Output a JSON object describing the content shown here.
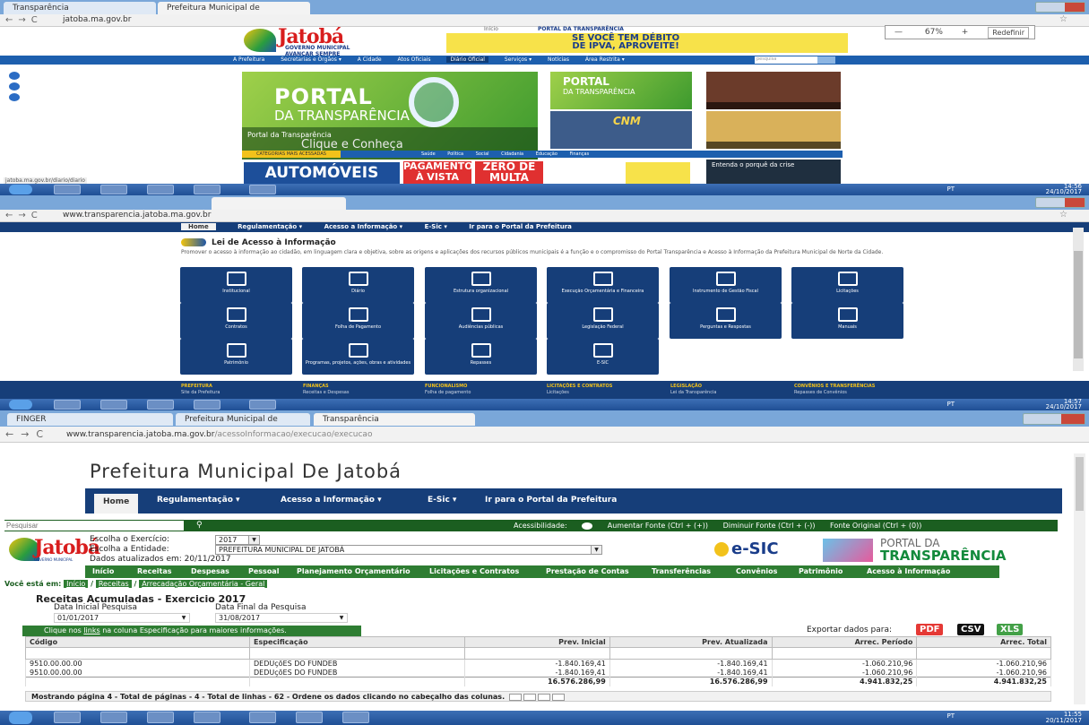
{
  "shot1": {
    "tabs": [
      "Transparência",
      "Prefeitura Municipal de",
      ""
    ],
    "url": "jatoba.ma.gov.br",
    "zoom": {
      "value": "67%",
      "minus": "—",
      "plus": "+",
      "reset": "Redefinir"
    },
    "logo": {
      "name": "Jatobá",
      "subtitle": "GOVERNO MUNICIPAL",
      "slogan": "AVANÇAR SEMPRE"
    },
    "top_links": {
      "home": "Início",
      "portal": "PORTAL DA TRANSPARÊNCIA"
    },
    "ipva_banner": {
      "line1": "SE VOCÊ TEM DÉBITO",
      "line2": "DE IPVA, APROVEITE!"
    },
    "menu": [
      "A Prefeitura",
      "Secretarias e Órgãos ▾",
      "A Cidade",
      "Atos Oficiais",
      "Diário Oficial",
      "Serviços ▾",
      "Notícias",
      "Área Restrita ▾"
    ],
    "search_placeholder": "pesquisa",
    "big_portal": {
      "title": "PORTAL",
      "subtitle": "DA TRANSPARÊNCIA",
      "caption_title": "Portal da Transparência",
      "caption_cta": "Clique e Conheça"
    },
    "small_portal": {
      "title": "PORTAL",
      "subtitle": "DA TRANSPARÊNCIA"
    },
    "cnm_logo": "CNM",
    "categories_label": "CATEGORIAS MAIS ACESSADAS",
    "categories": [
      "Saúde",
      "Política",
      "Social",
      "Cidadania",
      "Educação",
      "Finanças"
    ],
    "autos": "AUTOMÓVEIS",
    "pagamento": {
      "a": "PAGAMENTO À VISTA",
      "b": "ZERO DE MULTA"
    },
    "crise": "Entenda o porquê da crise",
    "status_url": "jatoba.ma.gov.br/diario/diario",
    "taskbar": {
      "lang": "PT",
      "time": "14:56",
      "date": "24/10/2017"
    }
  },
  "shot2": {
    "url": "www.transparencia.jatoba.ma.gov.br",
    "menu": [
      "Home",
      "Regulamentação ▾",
      "Acesso a Informação ▾",
      "E-Sic ▾",
      "Ir para o Portal da Prefeitura"
    ],
    "title": "Lei de Acesso à Informação",
    "description": "Promover o acesso à informação ao cidadão, em linguagem clara e objetiva, sobre as origens e aplicações dos recursos públicos municipais é a função e o compromisso do Portal Transparência e Acesso à Informação da Prefeitura Municipal de Norte da Cidade.",
    "tiles": [
      "Institucional",
      "Diário",
      "Estrutura organizacional",
      "Execução Orçamentária e Financeira",
      "Instrumento de Gestão Fiscal",
      "Licitações",
      "Contratos",
      "Folha de Pagamento",
      "Audiências públicas",
      "Legislação Federal",
      "Perguntas e Respostas",
      "Manuais",
      "Patrimônio",
      "Programas, projetos, ações, obras e atividades",
      "Repasses",
      "E-SIC"
    ],
    "footer": [
      {
        "head": "PREFEITURA",
        "sub": "Site da Prefeitura"
      },
      {
        "head": "FINANÇAS",
        "sub": "Receitas e Despesas"
      },
      {
        "head": "FUNCIONALISMO",
        "sub": "Folha de pagamento"
      },
      {
        "head": "LICITAÇÕES E CONTRATOS",
        "sub": "Licitações"
      },
      {
        "head": "LEGISLAÇÃO",
        "sub": "Lei da Transparência"
      },
      {
        "head": "CONVÊNIOS E TRANSFERÊNCIAS",
        "sub": "Repasses de Convênios"
      }
    ],
    "taskbar": {
      "lang": "PT",
      "time": "14:57",
      "date": "24/10/2017"
    }
  },
  "shot3": {
    "tabs": [
      "FINGER",
      "Prefeitura Municipal de",
      "Transparência"
    ],
    "url_host": "www.transparencia.jatoba.ma.gov.br",
    "url_path": "/acessoInformacao/execucao/execucao",
    "page_title": "Prefeitura Municipal De Jatobá",
    "menu": {
      "home": "Home",
      "reg": "Regulamentação ▾",
      "acesso": "Acesso a Informação ▾",
      "esic": "E-Sic ▾",
      "portal": "Ir para o Portal da Prefeitura"
    },
    "search_placeholder": "Pesquisar",
    "accessibility": {
      "label": "Acessibilidade:",
      "increase": "Aumentar Fonte (Ctrl + (+))",
      "decrease": "Diminuir Fonte (Ctrl + (-))",
      "original": "Fonte Original (Ctrl + (0))"
    },
    "logo": {
      "name": "Jatobá",
      "sub": "GOVERNO MUNICIPAL"
    },
    "form": {
      "exercicio_label": "Escolha o Exercício:",
      "exercicio_value": "2017",
      "entidade_label": "Escolha a Entidade:",
      "entidade_value": "PREFEITURA MUNICIPAL DE JATOBÁ",
      "updated": "Dados atualizados em: 20/11/2017"
    },
    "esic": "e-SIC",
    "portal_logo": {
      "a": "PORTAL DA",
      "b": "TRANSPARÊNCIA"
    },
    "green_menu": [
      "Início",
      "Receitas",
      "Despesas",
      "Pessoal",
      "Planejamento Orçamentário",
      "Licitações e Contratos",
      "Prestação de Contas",
      "Transferências",
      "Convênios",
      "Patrimônio",
      "Acesso à Informação"
    ],
    "breadcrumb": {
      "label": "Você está em:",
      "items": [
        "Início",
        "Receitas",
        "Arrecadação Orçamentária - Geral"
      ]
    },
    "report": {
      "title": "Receitas Acumuladas - Exercicio 2017",
      "start_label": "Data Inicial Pesquisa",
      "start_value": "01/01/2017",
      "end_label": "Data Final da Pesquisa",
      "end_value": "31/08/2017",
      "info_pre": "Clique nos ",
      "info_link": "links",
      "info_post": " na coluna Especificação para maiores informações.",
      "export_label": "Exportar dados para:",
      "export": [
        "PDF",
        "CSV",
        "XLS"
      ],
      "columns": [
        "Código",
        "Especificação",
        "Prev. Inicial",
        "Prev. Atualizada",
        "Arrec. Período",
        "Arrec. Total"
      ],
      "rows": [
        [
          "9510.00.00.00",
          "DEDUçõES DO FUNDEB",
          "-1.840.169,41",
          "-1.840.169,41",
          "-1.060.210,96",
          "-1.060.210,96"
        ],
        [
          "9510.00.00.00",
          "DEDUçõES DO FUNDEB",
          "-1.840.169,41",
          "-1.840.169,41",
          "-1.060.210,96",
          "-1.060.210,96"
        ]
      ],
      "totals": [
        "16.576.286,99",
        "16.576.286,99",
        "4.941.832,25",
        "4.941.832,25"
      ],
      "pager": "Mostrando página 4 - Total de páginas - 4 - Total de linhas - 62 - Ordene os dados clicando no cabeçalho das colunas."
    },
    "taskbar": {
      "lang": "PT",
      "time": "11:55",
      "date": "20/11/2017"
    }
  }
}
